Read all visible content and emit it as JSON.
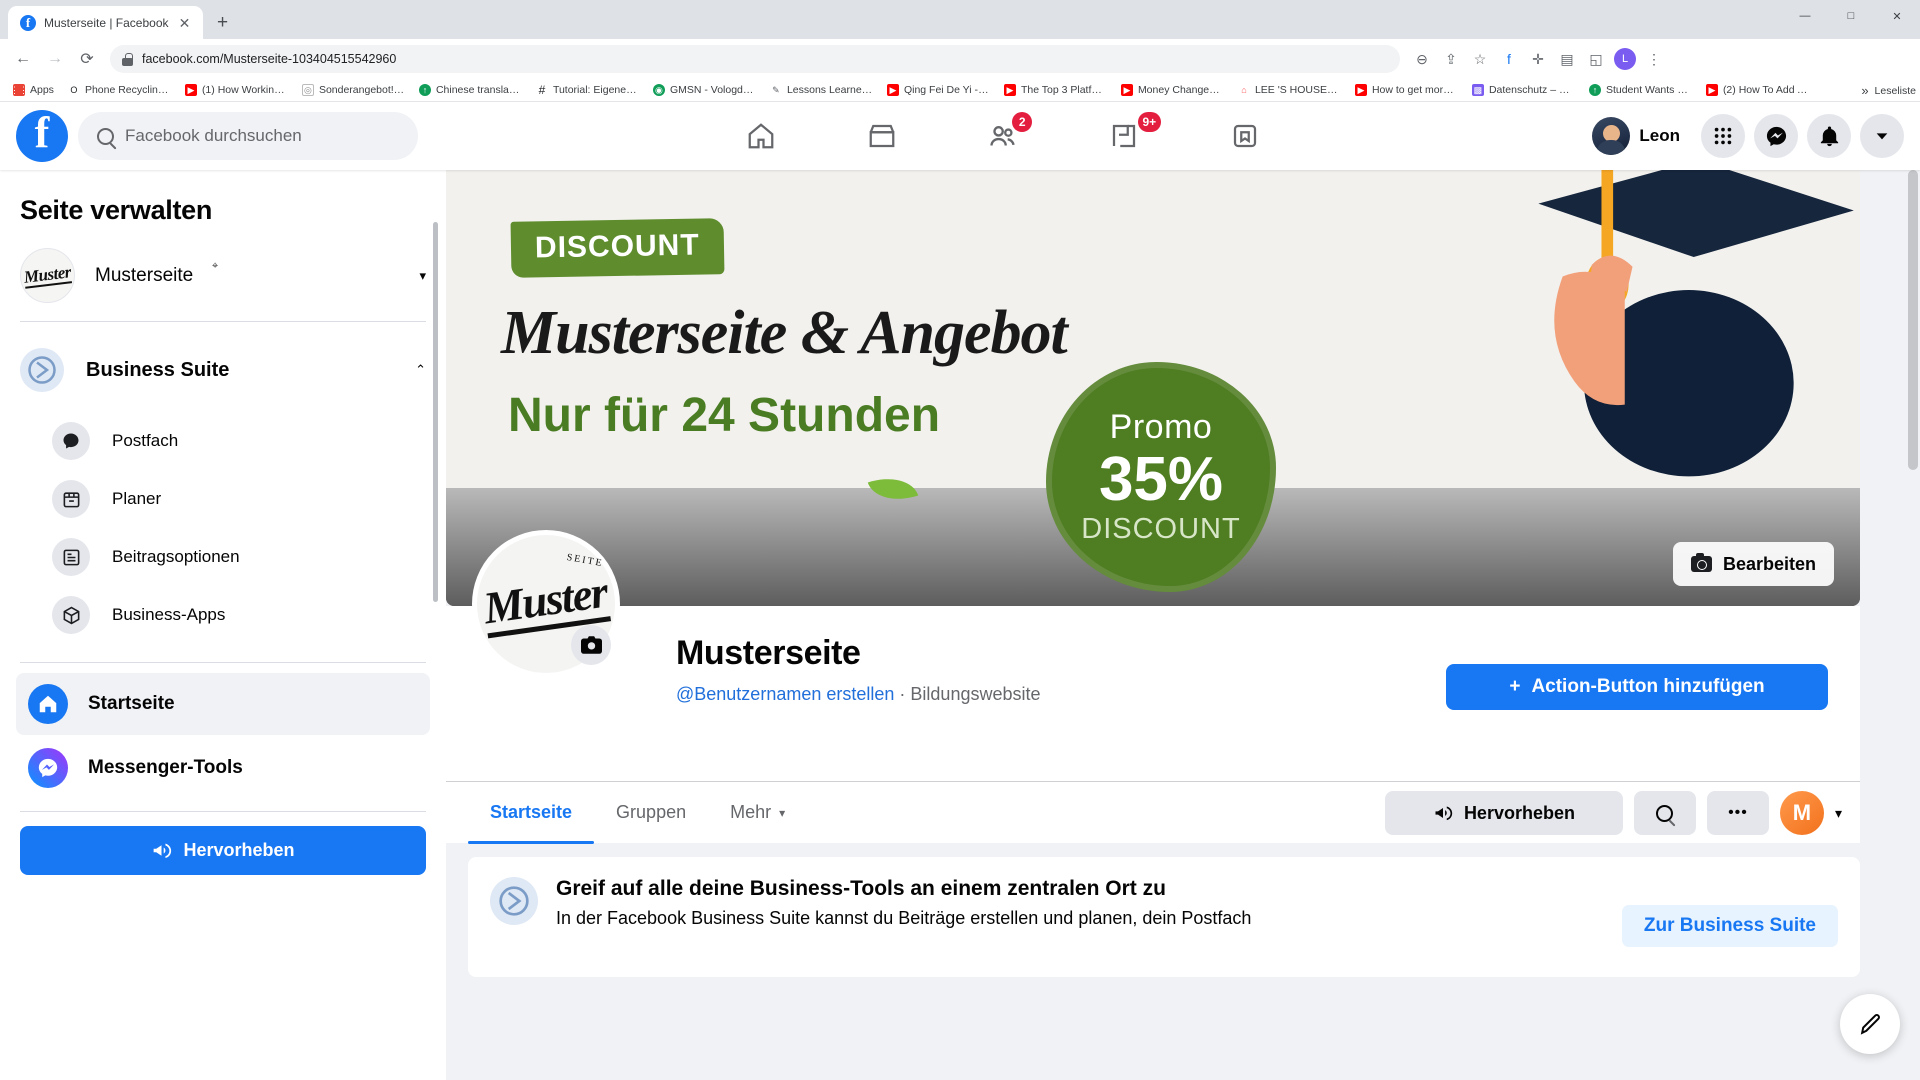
{
  "browser": {
    "tab": {
      "title": "Musterseite | Facebook",
      "favicon": "facebook-icon",
      "close": "✕"
    },
    "new_tab_label": "+",
    "window_controls": [
      "—",
      "□",
      "✕"
    ],
    "nav": {
      "back": "←",
      "forward": "→",
      "reload": "⟳"
    },
    "url": "facebook.com/Musterseite-103404515542960",
    "toolbar_icons": [
      "zoom-icon",
      "share-icon",
      "star-icon",
      "facebook-icon",
      "extension-icon",
      "list-icon",
      "cast-icon",
      "profile-icon",
      "menu-icon"
    ],
    "bookmarks": [
      {
        "label": "Apps",
        "icon": "apps-grid-icon",
        "color": "#ea4335"
      },
      {
        "label": "Phone Recycling,...",
        "icon": "o2-icon",
        "color": "#1c1e21"
      },
      {
        "label": "(1) How Working a...",
        "icon": "youtube-icon",
        "color": "#ff0000"
      },
      {
        "label": "Sonderangebot! |...",
        "icon": "globe-icon",
        "color": "#888888"
      },
      {
        "label": "Chinese translatio...",
        "icon": "green-circle-icon",
        "color": "#0f9d58"
      },
      {
        "label": "Tutorial: Eigene Fa...",
        "icon": "hash-icon",
        "color": "#1c1e21"
      },
      {
        "label": "GMSN - Vologda,...",
        "icon": "green-circle-icon",
        "color": "#0f9d58"
      },
      {
        "label": "Lessons Learned f...",
        "icon": "pen-icon",
        "color": "#5f6368"
      },
      {
        "label": "Qing Fei De Yi - Y...",
        "icon": "youtube-icon",
        "color": "#ff0000"
      },
      {
        "label": "The Top 3 Platfor...",
        "icon": "youtube-icon",
        "color": "#ff0000"
      },
      {
        "label": "Money Changes E...",
        "icon": "youtube-icon",
        "color": "#ff0000"
      },
      {
        "label": "LEE 'S HOUSE—...",
        "icon": "airbnb-icon",
        "color": "#ff5a5f"
      },
      {
        "label": "How to get more v...",
        "icon": "youtube-icon",
        "color": "#ff0000"
      },
      {
        "label": "Datenschutz – Re...",
        "icon": "image-icon",
        "color": "#7a5cf0"
      },
      {
        "label": "Student Wants an...",
        "icon": "green-circle-icon",
        "color": "#0f9d58"
      },
      {
        "label": "(2) How To Add A...",
        "icon": "youtube-icon",
        "color": "#ff0000"
      }
    ],
    "bookmarks_overflow": "»",
    "reading_list": "Leseliste"
  },
  "fb_header": {
    "logo": "facebook-logo",
    "search_placeholder": "Facebook durchsuchen",
    "nav_tabs": [
      {
        "name": "home",
        "icon": "home-icon",
        "badge": null
      },
      {
        "name": "marketplace",
        "icon": "marketplace-icon",
        "badge": null
      },
      {
        "name": "groups",
        "icon": "groups-icon",
        "badge": "2"
      },
      {
        "name": "gaming",
        "icon": "gaming-icon",
        "badge": "9+"
      },
      {
        "name": "pages",
        "icon": "flag-icon",
        "badge": null
      }
    ],
    "profile_name": "Leon",
    "right_icons": [
      {
        "name": "menu-grid-icon",
        "glyph": "⠿"
      },
      {
        "name": "messenger-icon",
        "glyph": "⚡"
      },
      {
        "name": "notifications-icon",
        "glyph": "🔔"
      },
      {
        "name": "account-chevron-icon",
        "glyph": "▾"
      }
    ]
  },
  "sidebar": {
    "title": "Seite verwalten",
    "page": {
      "name": "Musterseite",
      "avatar_text": "Muster",
      "chevron": "▾"
    },
    "group": {
      "label": "Business Suite",
      "icon": "business-suite-icon",
      "chevron": "⌃",
      "items": [
        {
          "label": "Postfach",
          "icon": "inbox-bubble-icon",
          "glyph": "💬"
        },
        {
          "label": "Planer",
          "icon": "calendar-icon",
          "glyph": "▦"
        },
        {
          "label": "Beitragsoptionen",
          "icon": "post-options-icon",
          "glyph": "▤"
        },
        {
          "label": "Business-Apps",
          "icon": "apps-box-icon",
          "glyph": "◰"
        }
      ]
    },
    "items": [
      {
        "label": "Startseite",
        "icon": "home-filled-icon",
        "glyph": "⌂",
        "active": true
      },
      {
        "label": "Messenger-Tools",
        "icon": "messenger-icon",
        "glyph": "⚡",
        "active": false
      }
    ],
    "promote_button": {
      "label": "Hervorheben",
      "icon": "megaphone-icon",
      "glyph": "📣"
    }
  },
  "cover": {
    "discount_badge": "DISCOUNT",
    "headline": "Musterseite & Angebot",
    "subheadline": "Nur für 24 Stunden",
    "promo": {
      "line1": "Promo",
      "line2": "35%",
      "line3": "DISCOUNT"
    },
    "edit_button": {
      "label": "Bearbeiten",
      "icon": "camera-icon"
    }
  },
  "profile": {
    "avatar_text": "Muster",
    "avatar_sub": "SEITE",
    "camera_icon": "camera-icon",
    "name": "Musterseite",
    "username_link": "@Benutzernamen erstellen",
    "separator": "·",
    "category": "Bildungswebsite",
    "action_button": {
      "plus": "+",
      "label": "Action-Button hinzufügen"
    }
  },
  "page_tabs": {
    "tabs": [
      {
        "label": "Startseite",
        "active": true
      },
      {
        "label": "Gruppen",
        "active": false
      },
      {
        "label": "Mehr",
        "active": false,
        "chevron": "▾"
      }
    ],
    "highlight_button": {
      "label": "Hervorheben",
      "icon": "megaphone-icon",
      "glyph": "📣"
    },
    "search_icon": "search-icon",
    "more_icon": "more-horizontal-icon",
    "more_glyph": "•••",
    "avatar_letter": "M",
    "avatar_chevron": "▾"
  },
  "promo_card": {
    "icon": "business-suite-icon",
    "heading": "Greif auf alle deine Business-Tools an einem zentralen Ort zu",
    "body": "In der Facebook Business Suite kannst du Beiträge erstellen und planen, dein Postfach",
    "cta": "Zur Business Suite"
  },
  "fab": {
    "name": "compose-fab",
    "glyph": "✎"
  }
}
